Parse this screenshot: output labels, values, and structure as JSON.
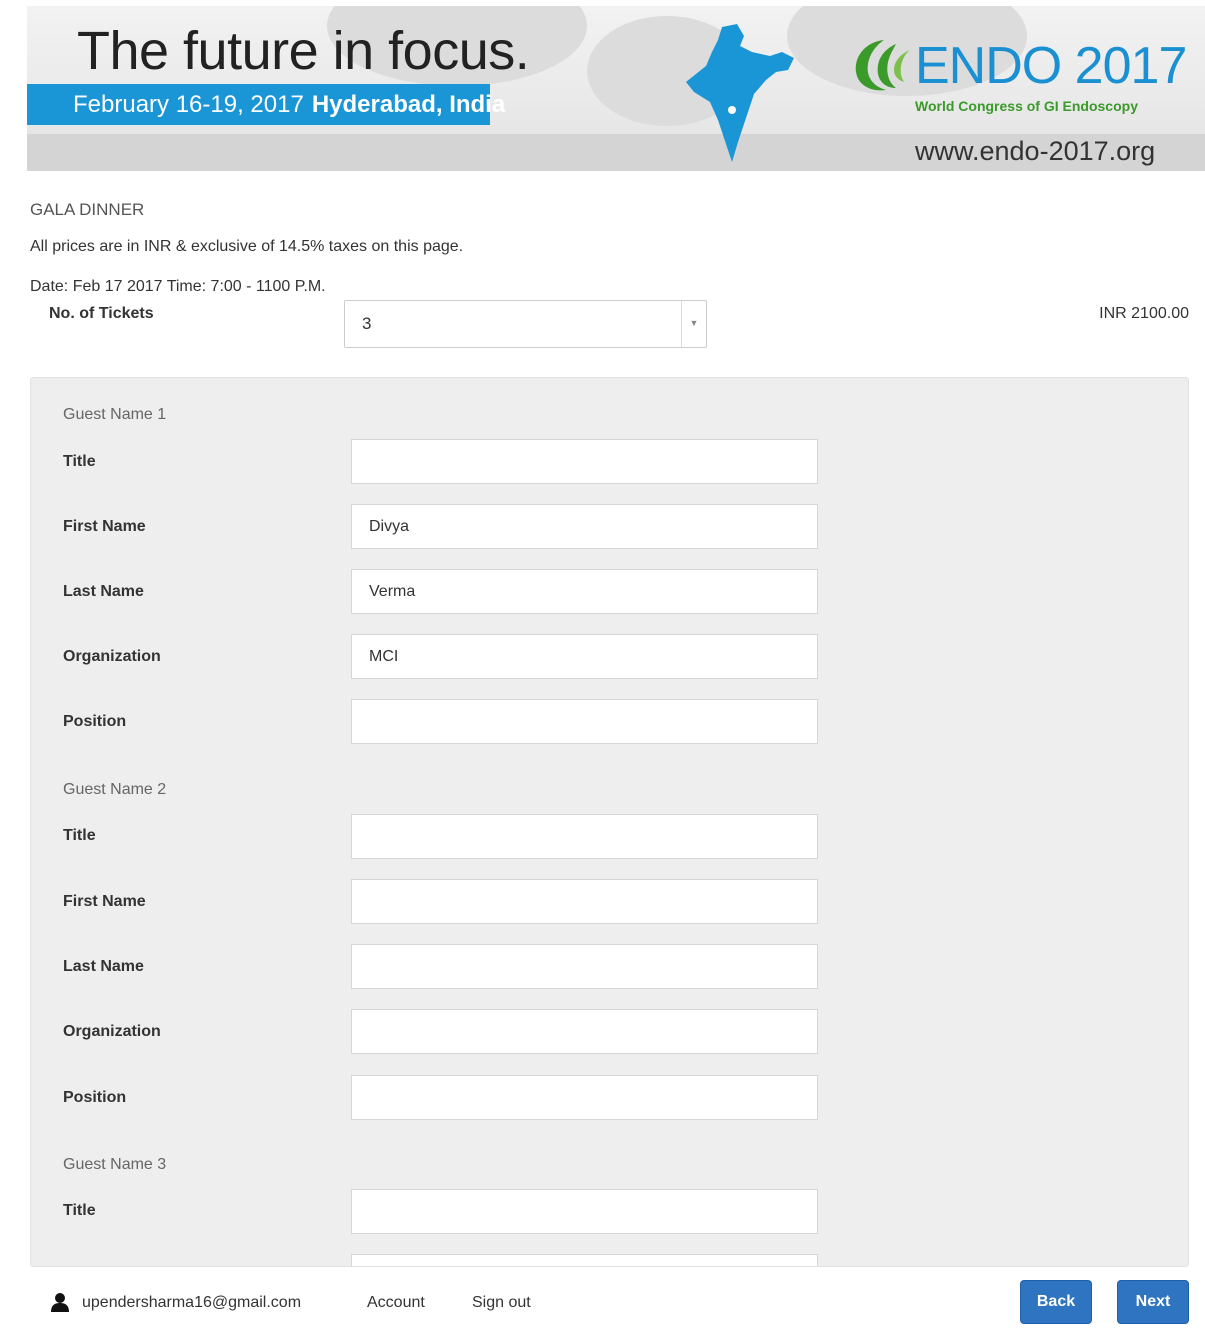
{
  "banner": {
    "tagline": "The future in focus.",
    "dates": "February 16-19, 2017",
    "location": "Hyderabad, India",
    "logo_title": "ENDO 2017",
    "logo_subtitle": "World Congress of GI Endoscopy",
    "url": "www.endo-2017.org",
    "colors": {
      "accent": "#1a95d6",
      "logo_green": "#3a9a2a"
    }
  },
  "section": {
    "title": "GALA DINNER",
    "price_note": "All prices are in INR & exclusive of 14.5% taxes on this page.",
    "date_line": "Date: Feb 17 2017 Time: 7:00 - 1100 P.M."
  },
  "tickets": {
    "label": "No. of Tickets",
    "selected": "3",
    "price": "INR 2100.00"
  },
  "guests": [
    {
      "heading": "Guest Name 1",
      "fields": [
        {
          "label": "Title",
          "value": ""
        },
        {
          "label": "First Name",
          "value": "Divya"
        },
        {
          "label": "Last Name",
          "value": "Verma"
        },
        {
          "label": "Organization",
          "value": "MCI"
        },
        {
          "label": "Position",
          "value": ""
        }
      ]
    },
    {
      "heading": "Guest Name 2",
      "fields": [
        {
          "label": "Title",
          "value": ""
        },
        {
          "label": "First Name",
          "value": ""
        },
        {
          "label": "Last Name",
          "value": ""
        },
        {
          "label": "Organization",
          "value": ""
        },
        {
          "label": "Position",
          "value": ""
        }
      ]
    },
    {
      "heading": "Guest Name 3",
      "fields": [
        {
          "label": "Title",
          "value": ""
        }
      ]
    }
  ],
  "footer": {
    "user_icon": "user-icon",
    "email": "upendersharma16@gmail.com",
    "account": "Account",
    "sign_out": "Sign out",
    "back": "Back",
    "next": "Next",
    "button_color": "#2f74c0"
  }
}
